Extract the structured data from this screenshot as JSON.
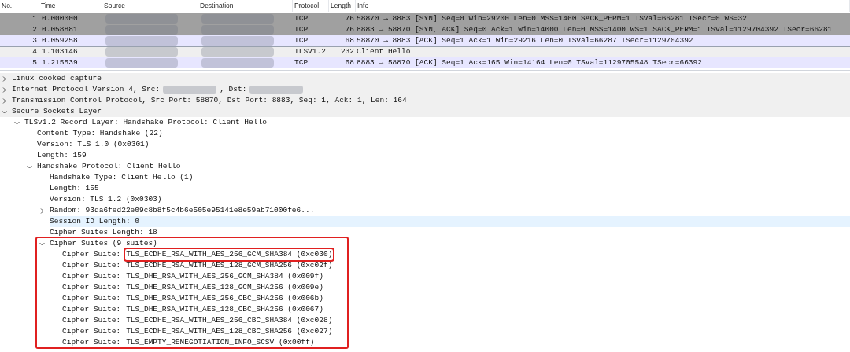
{
  "packet_list": {
    "columns": [
      "No.",
      "Time",
      "Source",
      "Destination",
      "Protocol",
      "Length",
      "Info"
    ],
    "rows": [
      {
        "no": "1",
        "time": "0.000000",
        "protocol": "TCP",
        "length": "76",
        "info": "58870 → 8883 [SYN] Seq=0 Win=29200 Len=0 MSS=1460 SACK_PERM=1 TSval=66281 TSecr=0 WS=32",
        "color": "#a0a0a0",
        "selected": false
      },
      {
        "no": "2",
        "time": "0.058881",
        "protocol": "TCP",
        "length": "76",
        "info": "8883 → 58870 [SYN, ACK] Seq=0 Ack=1 Win=14000 Len=0 MSS=1400 WS=1 SACK_PERM=1 TSval=1129704392 TSecr=66281",
        "color": "#a0a0a0",
        "selected": false
      },
      {
        "no": "3",
        "time": "0.059258",
        "protocol": "TCP",
        "length": "68",
        "info": "58870 → 8883 [ACK] Seq=1 Ack=1 Win=29216 Len=0 TSval=66287 TSecr=1129704392",
        "color": "#e7e6ff",
        "selected": false
      },
      {
        "no": "4",
        "time": "1.103146",
        "protocol": "TLSv1.2",
        "length": "232",
        "info": "Client Hello",
        "color": "#efefef",
        "selected": true
      },
      {
        "no": "5",
        "time": "1.215539",
        "protocol": "TCP",
        "length": "68",
        "info": "8883 → 58870 [ACK] Seq=1 Ack=165 Win=14164 Len=0 TSval=1129705548 TSecr=66392",
        "color": "#e7e6ff",
        "selected": false
      }
    ]
  },
  "details": [
    {
      "label": "Linux cooked capture",
      "expanded": false,
      "selected": false
    },
    {
      "segments": [
        {
          "kind": "text",
          "text": "Internet Protocol Version 4, Src:"
        },
        {
          "kind": "redacted"
        },
        {
          "kind": "text",
          "text": ", Dst:"
        },
        {
          "kind": "redacted"
        }
      ],
      "expanded": false,
      "selected": false
    },
    {
      "label": "Transmission Control Protocol, Src Port: 58870, Dst Port: 8883, Seq: 1, Ack: 1, Len: 164",
      "expanded": false,
      "selected": false
    },
    {
      "label": "Secure Sockets Layer",
      "expanded": true,
      "selected": false,
      "children": [
        {
          "label": "TLSv1.2 Record Layer: Handshake Protocol: Client Hello",
          "expanded": true,
          "selected": false,
          "children": [
            {
              "label": "Content Type: Handshake (22)",
              "selected": false
            },
            {
              "label": "Version: TLS 1.0 (0x0301)",
              "selected": false
            },
            {
              "label": "Length: 159",
              "selected": false
            },
            {
              "label": "Handshake Protocol: Client Hello",
              "expanded": true,
              "selected": false,
              "children": [
                {
                  "label": "Handshake Type: Client Hello (1)",
                  "selected": false
                },
                {
                  "label": "Length: 155",
                  "selected": false
                },
                {
                  "label": "Version: TLS 1.2 (0x0303)",
                  "selected": false
                },
                {
                  "label": "Random: 93da6fed22e09c8b8f5c4b6e505e95141e8e59ab71000fe6...",
                  "expanded": false,
                  "selected": false
                },
                {
                  "label": "Session ID Length: 0",
                  "selected": true
                },
                {
                  "label": "Cipher Suites Length: 18",
                  "selected": false
                },
                {
                  "label": "Cipher Suites (9 suites)",
                  "expanded": true,
                  "selected": false,
                  "annotated": true,
                  "children": [
                    {
                      "label": "Cipher Suite:",
                      "value": "TLS_ECDHE_RSA_WITH_AES_256_GCM_SHA384 (0xc030)",
                      "selected": false,
                      "annotated": true
                    },
                    {
                      "label": "Cipher Suite:",
                      "value": "TLS_ECDHE_RSA_WITH_AES_128_GCM_SHA256 (0xc02f)",
                      "selected": false,
                      "annotated": false
                    },
                    {
                      "label": "Cipher Suite:",
                      "value": "TLS_DHE_RSA_WITH_AES_256_GCM_SHA384 (0x009f)",
                      "selected": false,
                      "annotated": false
                    },
                    {
                      "label": "Cipher Suite:",
                      "value": "TLS_DHE_RSA_WITH_AES_128_GCM_SHA256 (0x009e)",
                      "selected": false,
                      "annotated": false
                    },
                    {
                      "label": "Cipher Suite:",
                      "value": "TLS_DHE_RSA_WITH_AES_256_CBC_SHA256 (0x006b)",
                      "selected": false,
                      "annotated": false
                    },
                    {
                      "label": "Cipher Suite:",
                      "value": "TLS_DHE_RSA_WITH_AES_128_CBC_SHA256 (0x0067)",
                      "selected": false,
                      "annotated": false
                    },
                    {
                      "label": "Cipher Suite:",
                      "value": "TLS_ECDHE_RSA_WITH_AES_256_CBC_SHA384 (0xc028)",
                      "selected": false,
                      "annotated": false
                    },
                    {
                      "label": "Cipher Suite:",
                      "value": "TLS_ECDHE_RSA_WITH_AES_128_CBC_SHA256 (0xc027)",
                      "selected": false,
                      "annotated": false
                    },
                    {
                      "label": "Cipher Suite:",
                      "value": "TLS_EMPTY_RENEGOTIATION_INFO_SCSV (0x00ff)",
                      "selected": false,
                      "annotated": false
                    }
                  ]
                }
              ]
            }
          ]
        }
      ]
    }
  ]
}
